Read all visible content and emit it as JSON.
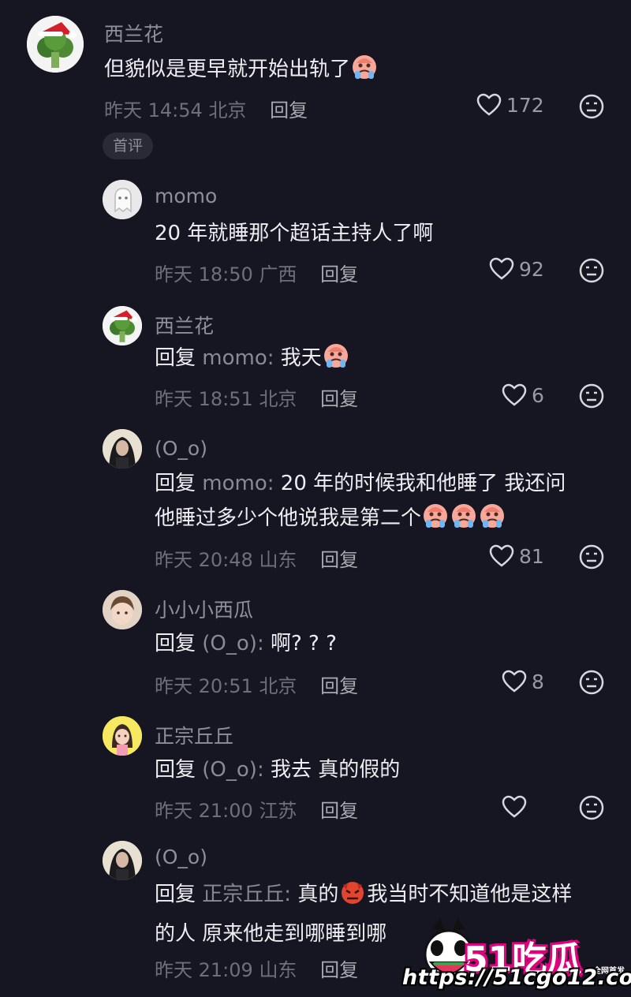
{
  "top_badge": "首评",
  "comments": [
    {
      "user": "西兰花",
      "avatar": "broccoli-santa-avatar",
      "prefix": "",
      "mention": "",
      "line1": "但貌似是更早就开始出轨了",
      "line2": "",
      "emojis": [
        "crying-emoji"
      ],
      "time": "昨天 14:54",
      "location": "北京",
      "reply_label": "回复",
      "likes": "172"
    },
    {
      "user": "momo",
      "avatar": "ghost-avatar",
      "prefix": "",
      "mention": "",
      "line1": "20 年就睡那个超话主持人了啊",
      "line2": "",
      "emojis": [],
      "time": "昨天 18:50",
      "location": "广西",
      "reply_label": "回复",
      "likes": "92"
    },
    {
      "user": "西兰花",
      "avatar": "broccoli-santa-avatar",
      "prefix": "回复",
      "mention": "momo:",
      "line1": "我天",
      "line2": "",
      "emojis": [
        "crying-emoji"
      ],
      "time": "昨天 18:51",
      "location": "北京",
      "reply_label": "回复",
      "likes": "6"
    },
    {
      "user": "(O_o)",
      "avatar": "portrait-avatar",
      "prefix": "回复",
      "mention": "momo:",
      "line1": "20 年的时候我和他睡了 我还问",
      "line2": "他睡过多少个他说我是第二个",
      "emojis": [
        "crying-emoji",
        "crying-emoji",
        "crying-emoji"
      ],
      "time": "昨天 20:48",
      "location": "山东",
      "reply_label": "回复",
      "likes": "81"
    },
    {
      "user": "小小小西瓜",
      "avatar": "child-avatar",
      "prefix": "回复",
      "mention": "(O_o):",
      "line1": "啊? ? ?",
      "line2": "",
      "emojis": [],
      "time": "昨天 20:51",
      "location": "北京",
      "reply_label": "回复",
      "likes": "8"
    },
    {
      "user": "正宗丘丘",
      "avatar": "cartoon-girl-avatar",
      "prefix": "回复",
      "mention": "(O_o):",
      "line1": "我去 真的假的",
      "line2": "",
      "emojis": [],
      "time": "昨天 21:00",
      "location": "江苏",
      "reply_label": "回复",
      "likes": ""
    },
    {
      "user": "(O_o)",
      "avatar": "portrait-avatar",
      "prefix": "回复",
      "mention": "正宗丘丘:",
      "line1a": "真的",
      "line1b": "我当时不知道他是这样",
      "line2": "的人 原来他走到哪睡到哪",
      "emojis": [
        "angry-devil-emoji"
      ],
      "time": "昨天 21:09",
      "location": "山东",
      "reply_label": "回复",
      "likes": ""
    }
  ],
  "watermark": {
    "brand": "51吃瓜",
    "tag": "全网首发",
    "url": "https://51cgo12.com"
  },
  "colors": {
    "background": "#161622",
    "text": "#ededf2",
    "muted": "#6f6f79",
    "watermark_accent": "#e3007f"
  }
}
